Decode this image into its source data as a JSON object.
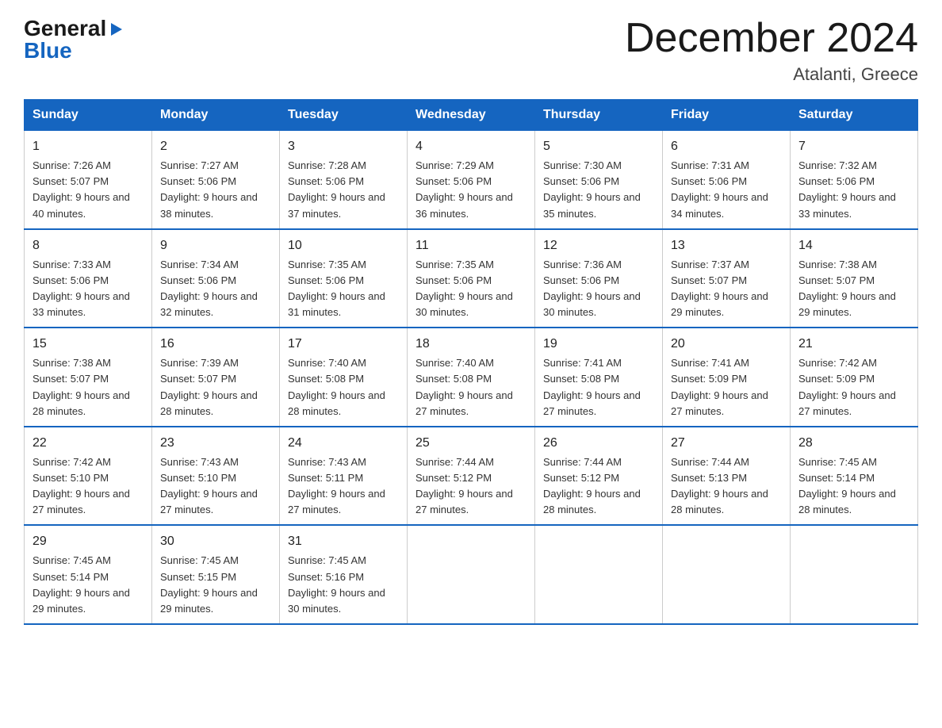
{
  "logo": {
    "line1": "General",
    "arrow": "▶",
    "line2": "Blue"
  },
  "title": "December 2024",
  "subtitle": "Atalanti, Greece",
  "days_of_week": [
    "Sunday",
    "Monday",
    "Tuesday",
    "Wednesday",
    "Thursday",
    "Friday",
    "Saturday"
  ],
  "weeks": [
    [
      {
        "day": "1",
        "sunrise": "7:26 AM",
        "sunset": "5:07 PM",
        "daylight": "9 hours and 40 minutes."
      },
      {
        "day": "2",
        "sunrise": "7:27 AM",
        "sunset": "5:06 PM",
        "daylight": "9 hours and 38 minutes."
      },
      {
        "day": "3",
        "sunrise": "7:28 AM",
        "sunset": "5:06 PM",
        "daylight": "9 hours and 37 minutes."
      },
      {
        "day": "4",
        "sunrise": "7:29 AM",
        "sunset": "5:06 PM",
        "daylight": "9 hours and 36 minutes."
      },
      {
        "day": "5",
        "sunrise": "7:30 AM",
        "sunset": "5:06 PM",
        "daylight": "9 hours and 35 minutes."
      },
      {
        "day": "6",
        "sunrise": "7:31 AM",
        "sunset": "5:06 PM",
        "daylight": "9 hours and 34 minutes."
      },
      {
        "day": "7",
        "sunrise": "7:32 AM",
        "sunset": "5:06 PM",
        "daylight": "9 hours and 33 minutes."
      }
    ],
    [
      {
        "day": "8",
        "sunrise": "7:33 AM",
        "sunset": "5:06 PM",
        "daylight": "9 hours and 33 minutes."
      },
      {
        "day": "9",
        "sunrise": "7:34 AM",
        "sunset": "5:06 PM",
        "daylight": "9 hours and 32 minutes."
      },
      {
        "day": "10",
        "sunrise": "7:35 AM",
        "sunset": "5:06 PM",
        "daylight": "9 hours and 31 minutes."
      },
      {
        "day": "11",
        "sunrise": "7:35 AM",
        "sunset": "5:06 PM",
        "daylight": "9 hours and 30 minutes."
      },
      {
        "day": "12",
        "sunrise": "7:36 AM",
        "sunset": "5:06 PM",
        "daylight": "9 hours and 30 minutes."
      },
      {
        "day": "13",
        "sunrise": "7:37 AM",
        "sunset": "5:07 PM",
        "daylight": "9 hours and 29 minutes."
      },
      {
        "day": "14",
        "sunrise": "7:38 AM",
        "sunset": "5:07 PM",
        "daylight": "9 hours and 29 minutes."
      }
    ],
    [
      {
        "day": "15",
        "sunrise": "7:38 AM",
        "sunset": "5:07 PM",
        "daylight": "9 hours and 28 minutes."
      },
      {
        "day": "16",
        "sunrise": "7:39 AM",
        "sunset": "5:07 PM",
        "daylight": "9 hours and 28 minutes."
      },
      {
        "day": "17",
        "sunrise": "7:40 AM",
        "sunset": "5:08 PM",
        "daylight": "9 hours and 28 minutes."
      },
      {
        "day": "18",
        "sunrise": "7:40 AM",
        "sunset": "5:08 PM",
        "daylight": "9 hours and 27 minutes."
      },
      {
        "day": "19",
        "sunrise": "7:41 AM",
        "sunset": "5:08 PM",
        "daylight": "9 hours and 27 minutes."
      },
      {
        "day": "20",
        "sunrise": "7:41 AM",
        "sunset": "5:09 PM",
        "daylight": "9 hours and 27 minutes."
      },
      {
        "day": "21",
        "sunrise": "7:42 AM",
        "sunset": "5:09 PM",
        "daylight": "9 hours and 27 minutes."
      }
    ],
    [
      {
        "day": "22",
        "sunrise": "7:42 AM",
        "sunset": "5:10 PM",
        "daylight": "9 hours and 27 minutes."
      },
      {
        "day": "23",
        "sunrise": "7:43 AM",
        "sunset": "5:10 PM",
        "daylight": "9 hours and 27 minutes."
      },
      {
        "day": "24",
        "sunrise": "7:43 AM",
        "sunset": "5:11 PM",
        "daylight": "9 hours and 27 minutes."
      },
      {
        "day": "25",
        "sunrise": "7:44 AM",
        "sunset": "5:12 PM",
        "daylight": "9 hours and 27 minutes."
      },
      {
        "day": "26",
        "sunrise": "7:44 AM",
        "sunset": "5:12 PM",
        "daylight": "9 hours and 28 minutes."
      },
      {
        "day": "27",
        "sunrise": "7:44 AM",
        "sunset": "5:13 PM",
        "daylight": "9 hours and 28 minutes."
      },
      {
        "day": "28",
        "sunrise": "7:45 AM",
        "sunset": "5:14 PM",
        "daylight": "9 hours and 28 minutes."
      }
    ],
    [
      {
        "day": "29",
        "sunrise": "7:45 AM",
        "sunset": "5:14 PM",
        "daylight": "9 hours and 29 minutes."
      },
      {
        "day": "30",
        "sunrise": "7:45 AM",
        "sunset": "5:15 PM",
        "daylight": "9 hours and 29 minutes."
      },
      {
        "day": "31",
        "sunrise": "7:45 AM",
        "sunset": "5:16 PM",
        "daylight": "9 hours and 30 minutes."
      },
      null,
      null,
      null,
      null
    ]
  ]
}
